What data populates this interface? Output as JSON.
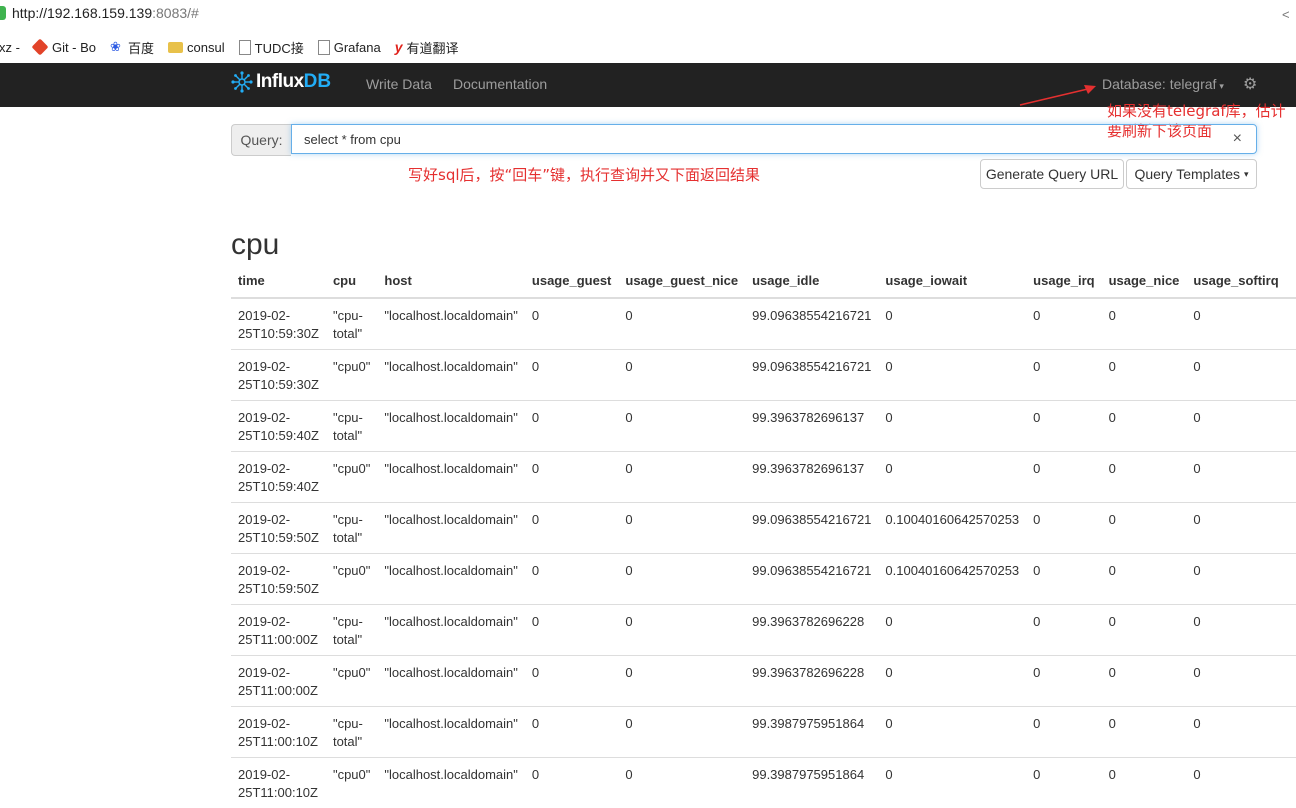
{
  "browser": {
    "url_host": "http://192.168.159.139",
    "url_rest": ":8083/#",
    "bookmarks": [
      {
        "label": "xz -",
        "icon": "none"
      },
      {
        "label": "Git - Bo",
        "icon": "git-icon"
      },
      {
        "label": "百度",
        "icon": "baidu-paw-icon"
      },
      {
        "label": "consul",
        "icon": "folder-icon"
      },
      {
        "label": "TUDC接",
        "icon": "page-icon"
      },
      {
        "label": "Grafana",
        "icon": "page-icon"
      },
      {
        "label": "有道翻译",
        "icon": "youdao-icon"
      }
    ]
  },
  "navbar": {
    "brand_influx": "Influx",
    "brand_db": "DB",
    "write_data": "Write Data",
    "documentation": "Documentation",
    "database_label": "Database: telegraf"
  },
  "query": {
    "label": "Query:",
    "value": "select * from cpu",
    "clear": "×",
    "generate_url": "Generate Query URL",
    "templates": "Query Templates"
  },
  "annotations": {
    "top_note": "如果没有telegraf库，估计要刷新下该页面",
    "query_note": "写好sql后，按“回车”键，执行查询并又下面返回结果"
  },
  "results": {
    "series_name": "cpu",
    "columns": [
      "time",
      "cpu",
      "host",
      "usage_guest",
      "usage_guest_nice",
      "usage_idle",
      "usage_iowait",
      "usage_irq",
      "usage_nice",
      "usage_softirq"
    ],
    "rows": [
      {
        "time_date": "2019-02-",
        "time_rest": "25T10:59:30Z",
        "cpu_a": "\"cpu-",
        "cpu_b": "total\"",
        "host": "\"localhost.localdomain\"",
        "usage_guest": "0",
        "usage_guest_nice": "0",
        "usage_idle": "99.09638554216721",
        "usage_iowait": "0",
        "usage_irq": "0",
        "usage_nice": "0",
        "usage_softirq": "0"
      },
      {
        "time_date": "2019-02-",
        "time_rest": "25T10:59:30Z",
        "cpu_a": "\"cpu0\"",
        "cpu_b": "",
        "host": "\"localhost.localdomain\"",
        "usage_guest": "0",
        "usage_guest_nice": "0",
        "usage_idle": "99.09638554216721",
        "usage_iowait": "0",
        "usage_irq": "0",
        "usage_nice": "0",
        "usage_softirq": "0"
      },
      {
        "time_date": "2019-02-",
        "time_rest": "25T10:59:40Z",
        "cpu_a": "\"cpu-",
        "cpu_b": "total\"",
        "host": "\"localhost.localdomain\"",
        "usage_guest": "0",
        "usage_guest_nice": "0",
        "usage_idle": "99.3963782696137",
        "usage_iowait": "0",
        "usage_irq": "0",
        "usage_nice": "0",
        "usage_softirq": "0"
      },
      {
        "time_date": "2019-02-",
        "time_rest": "25T10:59:40Z",
        "cpu_a": "\"cpu0\"",
        "cpu_b": "",
        "host": "\"localhost.localdomain\"",
        "usage_guest": "0",
        "usage_guest_nice": "0",
        "usage_idle": "99.3963782696137",
        "usage_iowait": "0",
        "usage_irq": "0",
        "usage_nice": "0",
        "usage_softirq": "0"
      },
      {
        "time_date": "2019-02-",
        "time_rest": "25T10:59:50Z",
        "cpu_a": "\"cpu-",
        "cpu_b": "total\"",
        "host": "\"localhost.localdomain\"",
        "usage_guest": "0",
        "usage_guest_nice": "0",
        "usage_idle": "99.09638554216721",
        "usage_iowait": "0.10040160642570253",
        "usage_irq": "0",
        "usage_nice": "0",
        "usage_softirq": "0"
      },
      {
        "time_date": "2019-02-",
        "time_rest": "25T10:59:50Z",
        "cpu_a": "\"cpu0\"",
        "cpu_b": "",
        "host": "\"localhost.localdomain\"",
        "usage_guest": "0",
        "usage_guest_nice": "0",
        "usage_idle": "99.09638554216721",
        "usage_iowait": "0.10040160642570253",
        "usage_irq": "0",
        "usage_nice": "0",
        "usage_softirq": "0"
      },
      {
        "time_date": "2019-02-",
        "time_rest": "25T11:00:00Z",
        "cpu_a": "\"cpu-",
        "cpu_b": "total\"",
        "host": "\"localhost.localdomain\"",
        "usage_guest": "0",
        "usage_guest_nice": "0",
        "usage_idle": "99.3963782696228",
        "usage_iowait": "0",
        "usage_irq": "0",
        "usage_nice": "0",
        "usage_softirq": "0"
      },
      {
        "time_date": "2019-02-",
        "time_rest": "25T11:00:00Z",
        "cpu_a": "\"cpu0\"",
        "cpu_b": "",
        "host": "\"localhost.localdomain\"",
        "usage_guest": "0",
        "usage_guest_nice": "0",
        "usage_idle": "99.3963782696228",
        "usage_iowait": "0",
        "usage_irq": "0",
        "usage_nice": "0",
        "usage_softirq": "0"
      },
      {
        "time_date": "2019-02-",
        "time_rest": "25T11:00:10Z",
        "cpu_a": "\"cpu-",
        "cpu_b": "total\"",
        "host": "\"localhost.localdomain\"",
        "usage_guest": "0",
        "usage_guest_nice": "0",
        "usage_idle": "99.3987975951864",
        "usage_iowait": "0",
        "usage_irq": "0",
        "usage_nice": "0",
        "usage_softirq": "0"
      },
      {
        "time_date": "2019-02-",
        "time_rest": "25T11:00:10Z",
        "cpu_a": "\"cpu0\"",
        "cpu_b": "",
        "host": "\"localhost.localdomain\"",
        "usage_guest": "0",
        "usage_guest_nice": "0",
        "usage_idle": "99.3987975951864",
        "usage_iowait": "0",
        "usage_irq": "0",
        "usage_nice": "0",
        "usage_softirq": "0"
      }
    ]
  },
  "colors": {
    "navbar_bg": "#222222",
    "brand_accent": "#22adf6",
    "annotation_red": "#e53030"
  }
}
